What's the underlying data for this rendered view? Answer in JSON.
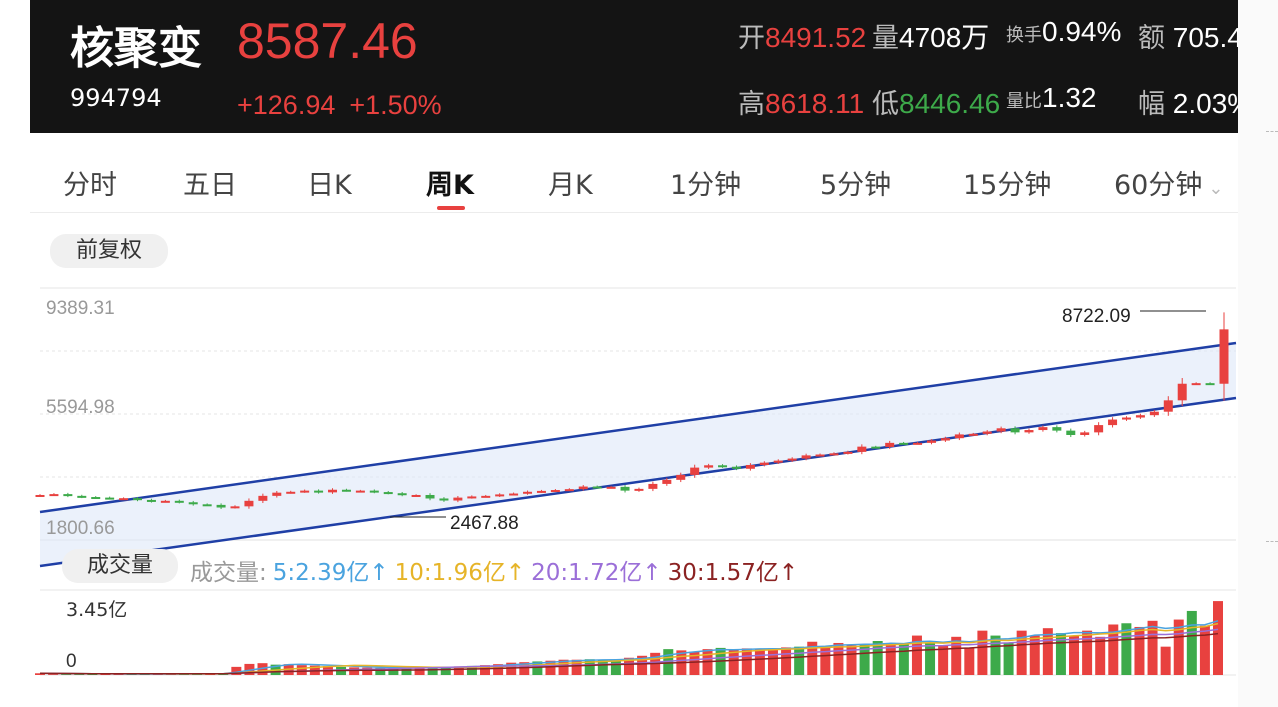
{
  "header": {
    "name": "核聚变",
    "code": "994794",
    "price": "8587.46",
    "change": "+126.94",
    "change_pct": "+1.50%",
    "open_label": "开",
    "open": "8491.52",
    "volume_label": "量",
    "volume": "4708万",
    "turnover_label": "换手",
    "turnover": "0.94%",
    "amount_label": "额",
    "amount": "705.4",
    "high_label": "高",
    "high": "8618.11",
    "low_label": "低",
    "low": "8446.46",
    "vol_ratio_label": "量比",
    "vol_ratio": "1.32",
    "range_label": "幅",
    "range": "2.03%"
  },
  "tabs": [
    {
      "label": "分时"
    },
    {
      "label": "五日"
    },
    {
      "label": "日K"
    },
    {
      "label": "周K",
      "active": true
    },
    {
      "label": "月K"
    },
    {
      "label": "1分钟"
    },
    {
      "label": "5分钟"
    },
    {
      "label": "15分钟"
    },
    {
      "label": "60分钟"
    }
  ],
  "adjust_label": "前复权",
  "volume_pill_label": "成交量",
  "volume_legend": {
    "title": "成交量:",
    "ma5": "5:2.39亿↑",
    "ma10": "10:1.96亿↑",
    "ma20": "20:1.72亿↑",
    "ma30": "30:1.57亿↑"
  },
  "colors": {
    "up": "#e8413f",
    "down": "#3daa4a",
    "channel": "#1f3fa6",
    "ma5": "#4aa3df",
    "ma10": "#e6b428",
    "ma20": "#9b6fd8",
    "ma30": "#8b2222"
  },
  "chart_data": {
    "type": "candlestick",
    "y_ticks": [
      "9389.31",
      "5594.98",
      "1800.66"
    ],
    "ylim": [
      1800.66,
      9389.31
    ],
    "max_label": "8722.09",
    "min_label": "2467.88",
    "volume_ticks": [
      "3.45亿",
      "0"
    ],
    "volume_ylim": [
      0,
      3.45
    ],
    "closes": [
      2900,
      2930,
      2870,
      2830,
      2810,
      2780,
      2790,
      2730,
      2680,
      2700,
      2650,
      2580,
      2560,
      2470,
      2510,
      2700,
      2870,
      2980,
      3010,
      3050,
      2990,
      3080,
      3050,
      3050,
      3000,
      2960,
      2900,
      2900,
      2780,
      2710,
      2810,
      2850,
      2870,
      2920,
      2950,
      3010,
      3040,
      3070,
      3100,
      3190,
      3160,
      3180,
      3050,
      3110,
      3280,
      3420,
      3590,
      3840,
      3920,
      3870,
      3800,
      3930,
      4010,
      4080,
      4150,
      4260,
      4290,
      4330,
      4380,
      4560,
      4550,
      4690,
      4670,
      4690,
      4770,
      4850,
      4980,
      5000,
      5080,
      5190,
      5050,
      5130,
      5230,
      5110,
      4960,
      5050,
      5300,
      5490,
      5560,
      5640,
      5760,
      6150,
      6720,
      6740,
      6720,
      8587
    ],
    "opens": [
      2880,
      2900,
      2930,
      2870,
      2830,
      2810,
      2780,
      2790,
      2730,
      2680,
      2700,
      2650,
      2580,
      2560,
      2470,
      2510,
      2700,
      2870,
      2980,
      3010,
      3050,
      2990,
      3080,
      3050,
      3050,
      3000,
      2960,
      2900,
      2900,
      2780,
      2710,
      2810,
      2850,
      2870,
      2920,
      2950,
      3010,
      3040,
      3070,
      3100,
      3190,
      3160,
      3180,
      3050,
      3110,
      3280,
      3420,
      3590,
      3840,
      3920,
      3870,
      3800,
      3930,
      4010,
      4080,
      4150,
      4260,
      4290,
      4330,
      4380,
      4560,
      4550,
      4690,
      4670,
      4690,
      4770,
      4850,
      4980,
      5000,
      5080,
      5190,
      5050,
      5130,
      5230,
      5110,
      4960,
      5050,
      5300,
      5490,
      5560,
      5640,
      5760,
      6150,
      6720,
      6740,
      6720
    ],
    "volumes": [
      0.07,
      0.06,
      0.05,
      0.04,
      0.05,
      0.04,
      0.04,
      0.04,
      0.04,
      0.05,
      0.04,
      0.05,
      0.05,
      0.06,
      0.07,
      0.33,
      0.45,
      0.48,
      0.42,
      0.44,
      0.4,
      0.38,
      0.36,
      0.33,
      0.31,
      0.3,
      0.29,
      0.29,
      0.3,
      0.31,
      0.3,
      0.33,
      0.35,
      0.37,
      0.4,
      0.44,
      0.5,
      0.52,
      0.55,
      0.58,
      0.62,
      0.62,
      0.64,
      0.6,
      0.62,
      0.7,
      0.78,
      0.9,
      1.05,
      1.0,
      0.95,
      1.05,
      1.1,
      1.02,
      1.08,
      1.05,
      1.08,
      1.12,
      1.15,
      1.35,
      1.15,
      1.3,
      1.2,
      1.25,
      1.38,
      1.3,
      1.25,
      1.6,
      1.3,
      1.2,
      1.55,
      1.1,
      1.8,
      1.6,
      1.3,
      1.8,
      1.6,
      1.9,
      1.7,
      1.6,
      1.8,
      1.55,
      2.05,
      2.1,
      1.95,
      2.2,
      1.15,
      2.25,
      2.6,
      2.0,
      3.0
    ]
  }
}
